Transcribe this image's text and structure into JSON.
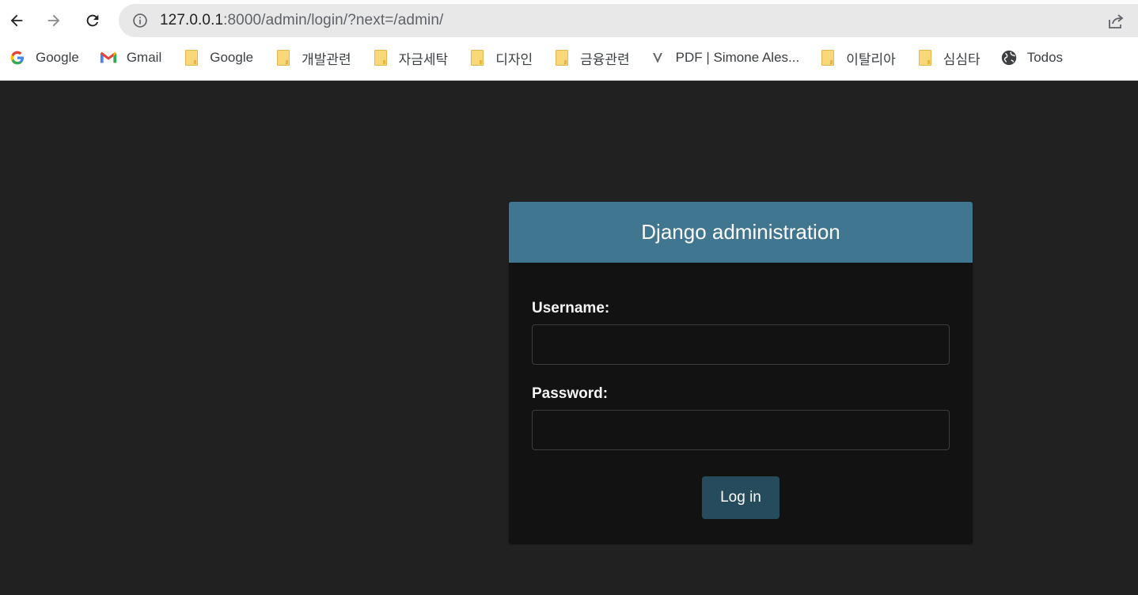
{
  "browser": {
    "url_host": "127.0.0.1",
    "url_path": ":8000/admin/login/?next=/admin/",
    "bookmarks": [
      {
        "label": "Google",
        "icon": "google-icon"
      },
      {
        "label": "Gmail",
        "icon": "gmail-icon"
      },
      {
        "label": "Google",
        "icon": "folder-icon"
      },
      {
        "label": "개발관련",
        "icon": "folder-icon"
      },
      {
        "label": "자금세탁",
        "icon": "folder-icon"
      },
      {
        "label": "디자인",
        "icon": "folder-icon"
      },
      {
        "label": "금융관련",
        "icon": "folder-icon"
      },
      {
        "label": "PDF | Simone Ales...",
        "icon": "v-logo-icon"
      },
      {
        "label": "이탈리아",
        "icon": "folder-icon"
      },
      {
        "label": "심심타",
        "icon": "folder-icon"
      },
      {
        "label": "Todos",
        "icon": "globe-icon"
      }
    ]
  },
  "login": {
    "header": "Django administration",
    "username_label": "Username:",
    "password_label": "Password:",
    "username_value": "",
    "password_value": "",
    "submit_label": "Log in"
  },
  "colors": {
    "page_bg": "#212121",
    "header_bg": "#417690",
    "button_bg": "#264b5d",
    "panel_bg": "#121212"
  }
}
